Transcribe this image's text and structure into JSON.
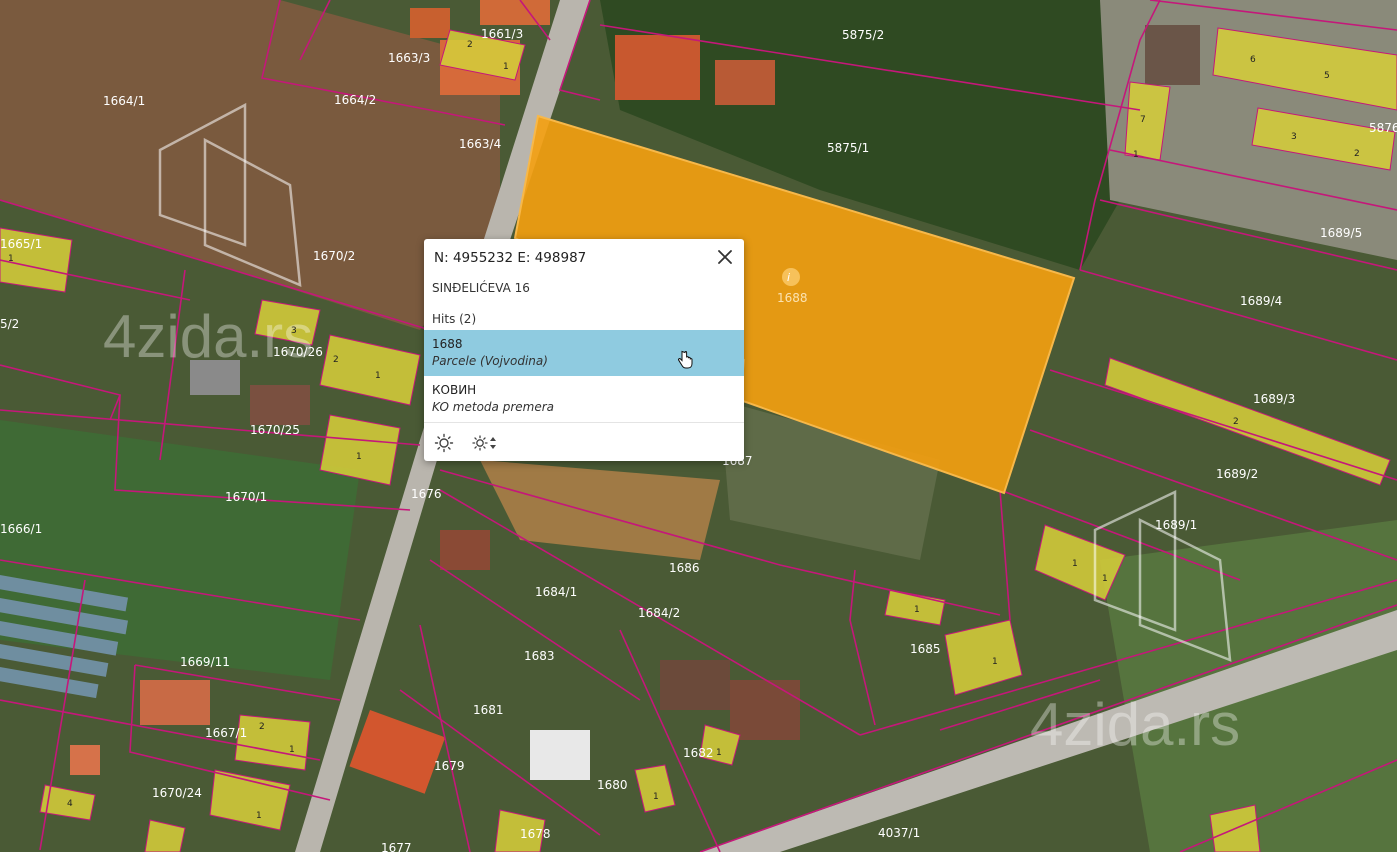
{
  "popup": {
    "coordinates": "N: 4955232  E: 498987",
    "address": "SINĐELIĆEVA 16",
    "hits_label": "Hits (2)",
    "hits": [
      {
        "title": "1688",
        "subtitle": "Parcele (Vojvodina)"
      },
      {
        "title": "КОВИН",
        "subtitle": "KO metoda premera"
      }
    ],
    "tools": [
      "brightness-icon",
      "brightness-adjust-icon"
    ]
  },
  "map": {
    "watermark": "4zida.rs",
    "selected_parcel": "1688",
    "parcel_labels": [
      "5875/2",
      "5875/1",
      "1661/3",
      "1663/3",
      "1664/1",
      "1664/2",
      "1663/4",
      "1665/1",
      "5/2",
      "1670/2",
      "1670/26",
      "1670/25",
      "1670/1",
      "1676",
      "1666/1",
      "1669/11",
      "1667/1",
      "1670/24",
      "1687",
      "1686",
      "1684/1",
      "1684/2",
      "1683",
      "1681",
      "1679",
      "1682",
      "1680",
      "1678",
      "1677",
      "1685",
      "5876",
      "1689/5",
      "1689/4",
      "1689/3",
      "1689/2",
      "1689/1",
      "4037/1"
    ],
    "building_numbers": [
      "2",
      "1",
      "6",
      "5",
      "7",
      "1",
      "3",
      "2",
      "1",
      "3",
      "2",
      "1",
      "1",
      "2",
      "1",
      "1",
      "4",
      "1",
      "2",
      "1",
      "1",
      "1",
      "1",
      "1"
    ],
    "colors": {
      "parcel_line": "#c5177a",
      "selected_fill": "#f5a00f",
      "building_fill": "#d4cc3a",
      "hit_highlight": "#8fcbe0"
    }
  }
}
